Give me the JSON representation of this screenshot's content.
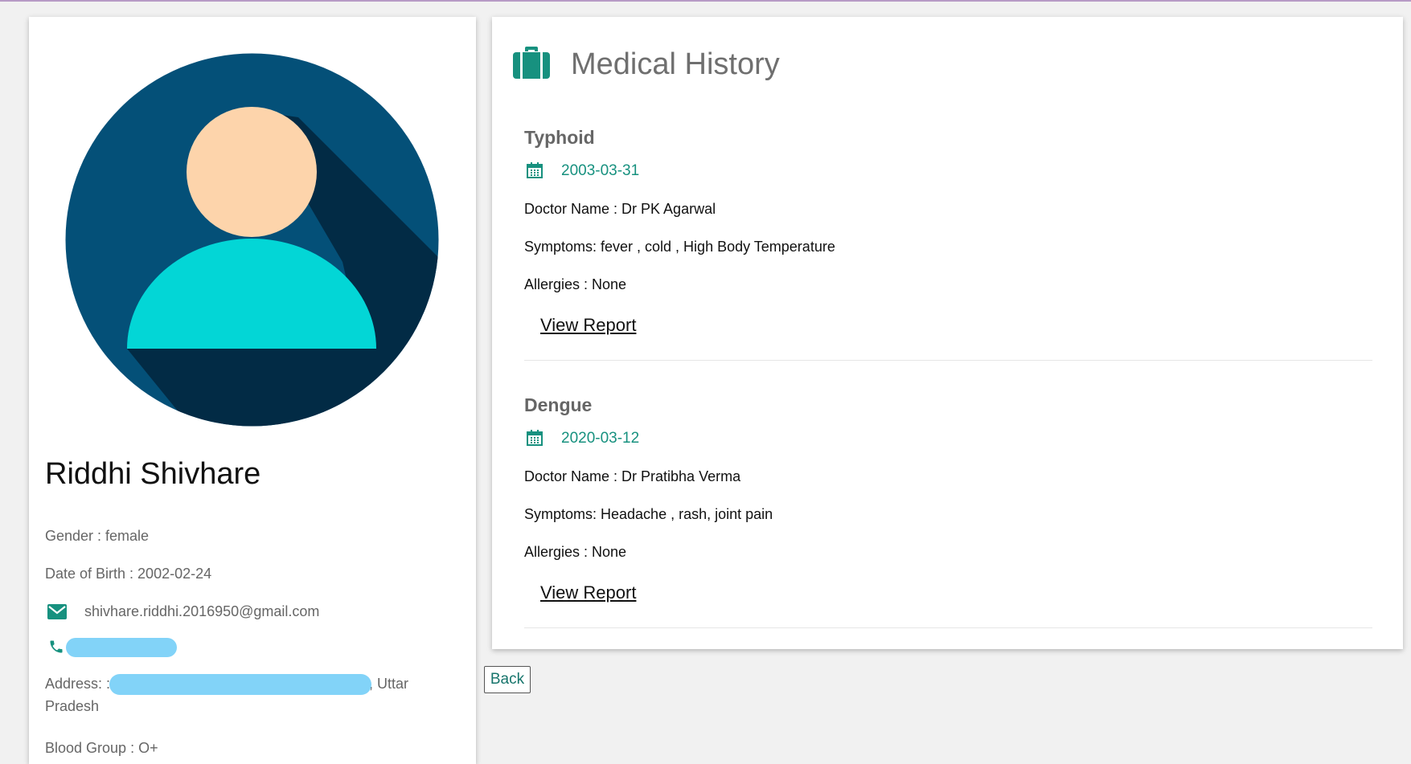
{
  "colors": {
    "accent": "#17917f",
    "avatar_bg": "#045078",
    "avatar_shadow": "#022b45",
    "avatar_skin": "#fdd4ab",
    "avatar_body": "#03d6d6",
    "redaction": "#82d3f8"
  },
  "profile": {
    "name": "Riddhi Shivhare",
    "gender": "Gender : female",
    "dob": "Date of Birth : 2002-02-24",
    "email": "shivhare.riddhi.2016950@gmail.com",
    "address_prefix": "Address: :",
    "address_suffix": ", Uttar Pradesh",
    "blood_group": "Blood Group : O+"
  },
  "history": {
    "title": "Medical History",
    "records": [
      {
        "disease": "Typhoid",
        "date": "2003-03-31",
        "doctor": "Doctor Name : Dr PK Agarwal",
        "symptoms": "Symptoms: fever , cold , High Body Temperature",
        "allergies": "Allergies : None",
        "report_label": "View Report"
      },
      {
        "disease": "Dengue",
        "date": "2020-03-12",
        "doctor": "Doctor Name : Dr Pratibha Verma",
        "symptoms": "Symptoms: Headache , rash, joint pain",
        "allergies": "Allergies : None",
        "report_label": "View Report"
      }
    ]
  },
  "back_label": "Back",
  "icons": {
    "title": "briefcase-icon",
    "date": "calendar-icon",
    "email": "envelope-icon",
    "phone": "phone-icon"
  }
}
